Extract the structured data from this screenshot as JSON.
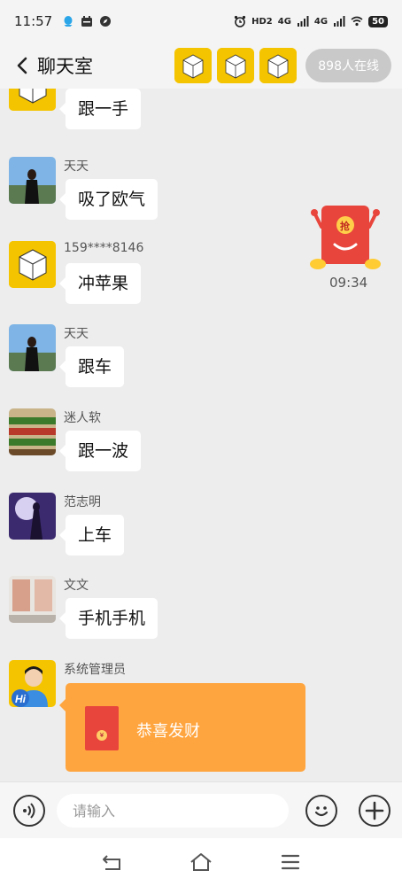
{
  "status_bar": {
    "time": "11:57",
    "network_1": "HD2",
    "network_2": "4G",
    "network_3": "4G",
    "battery": "50"
  },
  "header": {
    "title": "聊天室",
    "online_count": "898人在线"
  },
  "messages": [
    {
      "sender": "",
      "text": "跟一手",
      "avatar": "box-avatar"
    },
    {
      "sender": "天天",
      "text": "吸了欧气",
      "avatar": "photo-avatar"
    },
    {
      "sender": "159****8146",
      "text": "冲苹果",
      "avatar": "box-avatar"
    },
    {
      "sender": "天天",
      "text": "跟车",
      "avatar": "photo-avatar"
    },
    {
      "sender": "迷人软",
      "text": "跟一波",
      "avatar": "photo-avatar"
    },
    {
      "sender": "范志明",
      "text": "上车",
      "avatar": "photo-avatar"
    },
    {
      "sender": "文文",
      "text": "手机手机",
      "avatar": "photo-avatar"
    },
    {
      "sender": "系统管理员",
      "text": "恭喜发财",
      "avatar": "hi-avatar"
    }
  ],
  "floating_packet": {
    "label": "抢",
    "time": "09:34"
  },
  "input": {
    "placeholder": "请输入"
  },
  "colors": {
    "accent_yellow": "#f5c400",
    "red_packet_card": "#ffa53f",
    "red_packet": "#e8453c"
  }
}
